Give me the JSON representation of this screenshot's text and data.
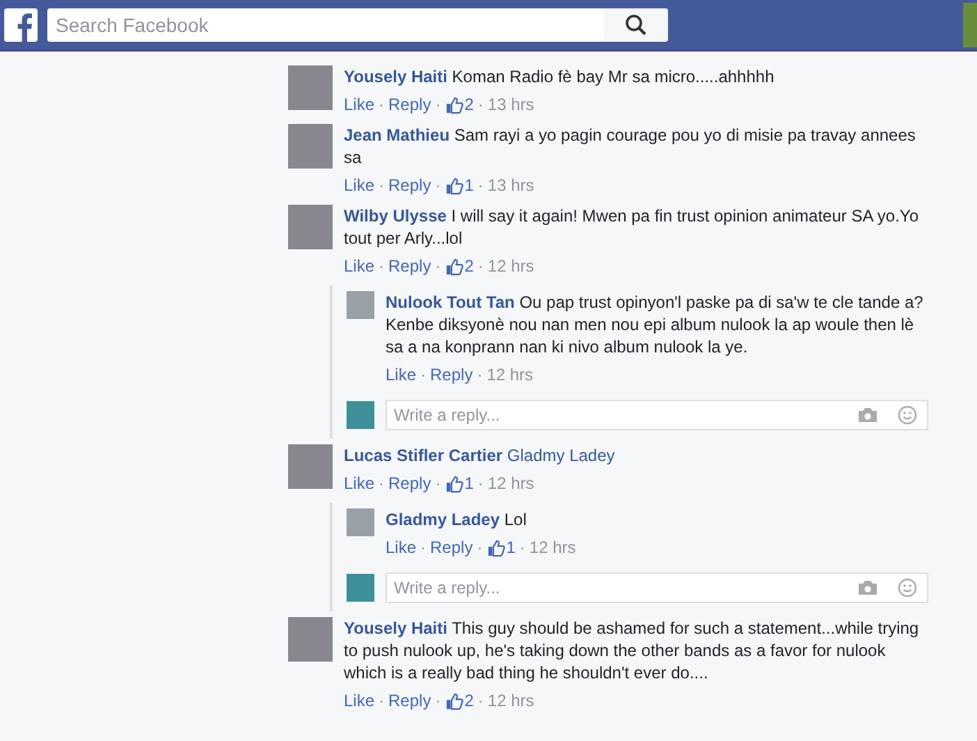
{
  "top_bar": {
    "search": {
      "placeholder": "Search Facebook"
    }
  },
  "separator": "·",
  "comments": [
    {
      "author": "Yousely Haiti",
      "text": "Koman Radio fè bay Mr sa micro.....ahhhhh",
      "like_label": "Like",
      "reply_label": "Reply",
      "likes": "2",
      "time": "13 hrs"
    },
    {
      "author": "Jean Mathieu",
      "text": "Sam rayi a yo pagin courage pou yo di misie pa travay annees sa",
      "like_label": "Like",
      "reply_label": "Reply",
      "likes": "1",
      "time": "13 hrs"
    },
    {
      "author": "Wilby Ulysse",
      "text": "I will say it again! Mwen pa fin trust opinion animateur SA yo.Yo tout per Arly...lol",
      "like_label": "Like",
      "reply_label": "Reply",
      "likes": "2",
      "time": "12 hrs",
      "replies": [
        {
          "author": "Nulook Tout Tan",
          "text": "Ou pap trust opinyon'l paske pa di sa'w te cle tande a? Kenbe diksyonè nou nan men nou epi album nulook la ap woule then lè sa a na konprann nan ki nivo album nulook la ye.",
          "like_label": "Like",
          "reply_label": "Reply",
          "time": "12 hrs"
        }
      ],
      "reply_box": {
        "placeholder": "Write a reply..."
      }
    },
    {
      "author": "Lucas Stifler Cartier",
      "mention": "Gladmy Ladey",
      "like_label": "Like",
      "reply_label": "Reply",
      "likes": "1",
      "time": "12 hrs",
      "replies": [
        {
          "author": "Gladmy Ladey",
          "text": "Lol",
          "like_label": "Like",
          "reply_label": "Reply",
          "likes": "1",
          "time": "12 hrs"
        }
      ],
      "reply_box": {
        "placeholder": "Write a reply..."
      }
    },
    {
      "author": "Yousely Haiti",
      "text": "This guy should be ashamed for such a statement...while trying to push nulook up, he's taking down the other bands as a favor for nulook which is a really bad thing he shouldn't ever do....",
      "like_label": "Like",
      "reply_label": "Reply",
      "likes": "2",
      "time": "12 hrs"
    }
  ]
}
